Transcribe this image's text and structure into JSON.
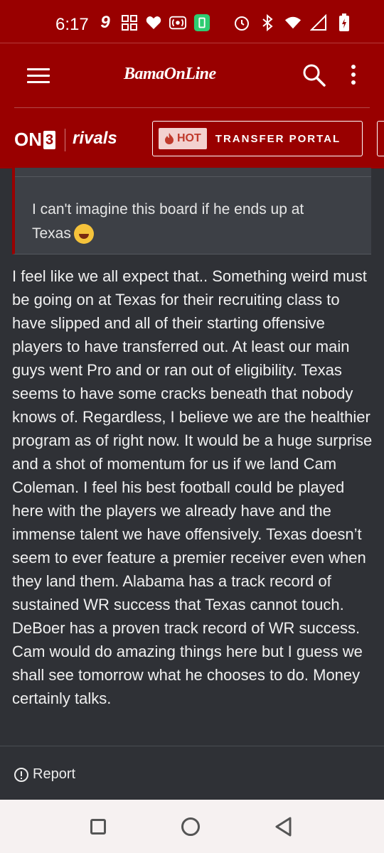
{
  "status_bar": {
    "time": "6:17",
    "icons_left": [
      "9-app-icon",
      "grid-app-icon",
      "heart-icon",
      "cast-icon",
      "battery-saver-icon"
    ],
    "icons_right": [
      "alarm-icon",
      "bluetooth-icon",
      "wifi-icon",
      "signal-icon",
      "battery-charging-icon"
    ]
  },
  "header": {
    "brand": "BamaOnLine",
    "network_logo": "ON",
    "network_logo_number": "3",
    "partner_logo": "rivals",
    "hot_badge": "HOT",
    "portal_label": "TRANSFER PORTAL"
  },
  "post": {
    "quote_text": "I can't imagine this board if he ends up at Texas",
    "body": "I feel like we all expect that.. Something weird must be going on at Texas for their recruiting class to have slipped and all of their starting offensive players to have transferred out. At least our main guys went Pro and or ran out of eligibility. Texas seems to have some cracks beneath that nobody knows of. Regardless, I believe we are the healthier program as of right now. It would be a huge surprise and a shot of momentum for us if we land Cam Coleman. I feel his best football could be played here with the players we already have and the immense talent we have offensively. Texas doesn’t seem to ever feature a premier receiver even when they land them. Alabama has a track record of sustained WR success that Texas cannot touch. DeBoer has a proven track record of WR success. Cam would do amazing things here but I guess we shall see tomorrow what he chooses to do. Money certainly talks.",
    "report_label": "Report"
  },
  "colors": {
    "brand_red": "#990000",
    "background": "#2f3136",
    "quote_bg": "#3d4046",
    "nav_bg": "#f6f1f1"
  }
}
